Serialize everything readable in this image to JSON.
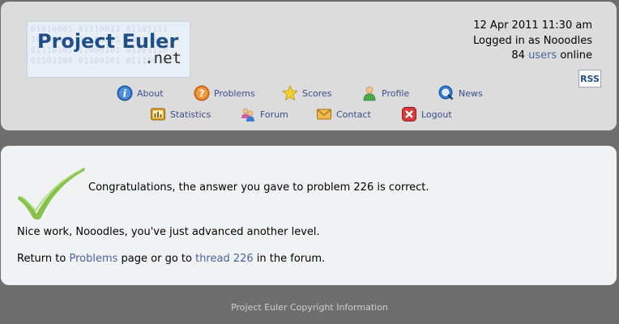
{
  "header": {
    "logo": {
      "title": "Project Euler",
      "suffix": ".net",
      "binary_rows": [
        "01010001 01110011 01101111",
        "10110100 01100011 00101011",
        "01110101 11000101 01101110",
        "01101100 01100101 01110010"
      ]
    },
    "datetime": "12 Apr 2011 11:30 am",
    "login_prefix": "Logged in as",
    "username": "Nooodles",
    "users_count": "84",
    "users_link": "users",
    "users_suffix": "online",
    "rss_label": "RSS"
  },
  "nav": {
    "about": "About",
    "problems": "Problems",
    "scores": "Scores",
    "profile": "Profile",
    "news": "News",
    "statistics": "Statistics",
    "forum": "Forum",
    "contact": "Contact",
    "logout": "Logout"
  },
  "main": {
    "message": "Congratulations, the answer you gave to problem 226 is correct.",
    "advance": "Nice work, Nooodles, you've just advanced another level.",
    "return_prefix": "Return to",
    "problems_link": "Problems",
    "return_middle": "page or go to",
    "thread_link": "thread 226",
    "return_suffix": "in the forum."
  },
  "footer": {
    "copyright": "Project Euler Copyright Information"
  },
  "colors": {
    "header_bg": "#dcdcdc",
    "main_bg": "#f0f2f4",
    "page_bg": "#6e6e6e",
    "link": "#4b63a0",
    "check_green": "#7fc241"
  }
}
